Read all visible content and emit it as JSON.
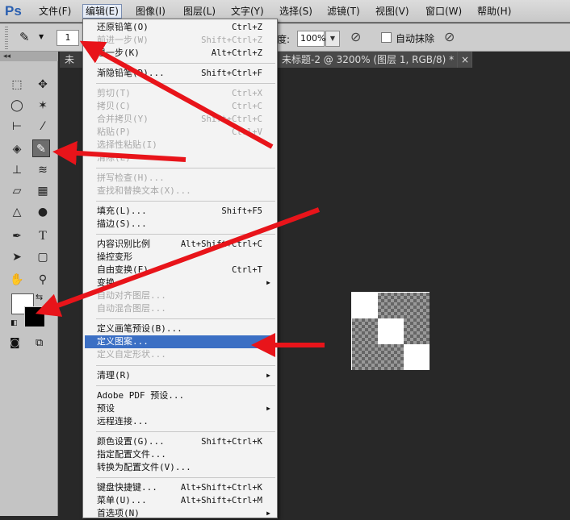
{
  "app_logo": "Ps",
  "menubar": [
    "文件(F)",
    "编辑(E)",
    "图像(I)",
    "图层(L)",
    "文字(Y)",
    "选择(S)",
    "滤镜(T)",
    "视图(V)",
    "窗口(W)",
    "帮助(H)"
  ],
  "options": {
    "brush_size": "1",
    "opacity_label": "度:",
    "opacity_value": "100%",
    "auto_erase_label": "自动抹除"
  },
  "tabs": [
    "未",
    "未标题-2 @ 3200% (图层 1, RGB/8) *",
    "×"
  ],
  "edit_menu": [
    {
      "label": "还原铅笔(O)",
      "shortcut": "Ctrl+Z"
    },
    {
      "label": "前进一步(W)",
      "shortcut": "Shift+Ctrl+Z",
      "disabled": true
    },
    {
      "label": "退一步(K)",
      "shortcut": "Alt+Ctrl+Z"
    },
    {
      "label": "渐隐铅笔(D)...",
      "shortcut": "Shift+Ctrl+F"
    },
    {
      "label": "剪切(T)",
      "shortcut": "Ctrl+X",
      "disabled": true
    },
    {
      "label": "拷贝(C)",
      "shortcut": "Ctrl+C",
      "disabled": true
    },
    {
      "label": "合并拷贝(Y)",
      "shortcut": "Shift+Ctrl+C",
      "disabled": true
    },
    {
      "label": "粘贴(P)",
      "shortcut": "Ctrl+V",
      "disabled": true
    },
    {
      "label": "选择性粘贴(I)",
      "shortcut": "",
      "disabled": true
    },
    {
      "label": "清除(E)",
      "shortcut": "",
      "disabled": true
    },
    {
      "label": "拼写检查(H)...",
      "shortcut": "",
      "disabled": true
    },
    {
      "label": "查找和替换文本(X)...",
      "shortcut": "",
      "disabled": true
    },
    {
      "label": "填充(L)...",
      "shortcut": "Shift+F5"
    },
    {
      "label": "描边(S)...",
      "shortcut": ""
    },
    {
      "label": "内容识别比例",
      "shortcut": "Alt+Shift+Ctrl+C"
    },
    {
      "label": "操控变形",
      "shortcut": ""
    },
    {
      "label": "自由变换(F)",
      "shortcut": "Ctrl+T"
    },
    {
      "label": "变换",
      "shortcut": "",
      "submenu": true
    },
    {
      "label": "自动对齐图层...",
      "shortcut": "",
      "disabled": true
    },
    {
      "label": "自动混合图层...",
      "shortcut": "",
      "disabled": true
    },
    {
      "label": "定义画笔预设(B)...",
      "shortcut": ""
    },
    {
      "label": "定义图案...",
      "shortcut": "",
      "highlighted": true
    },
    {
      "label": "定义自定形状...",
      "shortcut": "",
      "disabled": true
    },
    {
      "label": "清理(R)",
      "shortcut": "",
      "submenu": true
    },
    {
      "label": "Adobe PDF 预设...",
      "shortcut": ""
    },
    {
      "label": "预设",
      "shortcut": "",
      "submenu": true
    },
    {
      "label": "远程连接...",
      "shortcut": ""
    },
    {
      "label": "颜色设置(G)...",
      "shortcut": "Shift+Ctrl+K"
    },
    {
      "label": "指定配置文件...",
      "shortcut": ""
    },
    {
      "label": "转换为配置文件(V)...",
      "shortcut": ""
    },
    {
      "label": "键盘快捷键...",
      "shortcut": "Alt+Shift+Ctrl+K"
    },
    {
      "label": "菜单(U)...",
      "shortcut": "Alt+Shift+Ctrl+M"
    },
    {
      "label": "首选项(N)",
      "shortcut": "",
      "submenu": true
    }
  ],
  "colors": {
    "highlight": "#3b6fc4",
    "annotation_arrow": "#e8141a",
    "foreground": "#000000",
    "background": "#ffffff"
  }
}
